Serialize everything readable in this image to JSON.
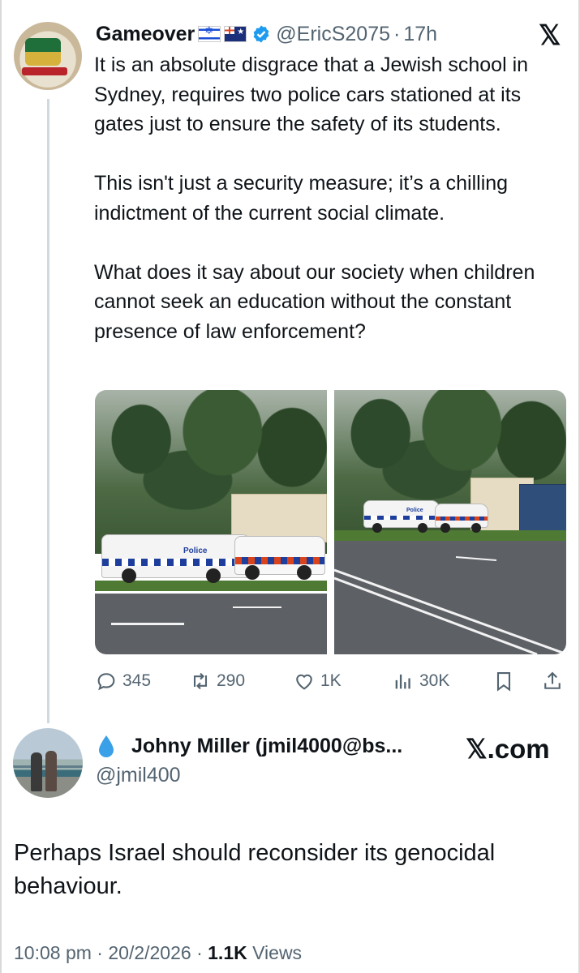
{
  "tweet": {
    "author_name": "Gameover",
    "handle": "@EricS2075",
    "separator": "·",
    "age": "17h",
    "flags": [
      "israel-flag",
      "australia-flag"
    ],
    "platform_logo": "𝕏",
    "paragraphs": [
      "It is an absolute disgrace that a Jewish school in Sydney, requires two police cars stationed at its gates just to ensure the safety of its students.",
      "This isn't just a security measure; it’s a chilling indictment of the current social climate.",
      "What does it say about our society when children cannot seek an education without the constant presence of law enforcement?"
    ],
    "photo_labels": [
      "Police",
      "Police"
    ],
    "actions": {
      "replies": "345",
      "retweets": "290",
      "likes": "1K",
      "views": "30K"
    }
  },
  "reply": {
    "author_name": "Johny Miller (jmil4000@bs...",
    "handle": "@jmil400",
    "source": "𝕏.com",
    "text": "Perhaps Israel should reconsider its genocidal behaviour.",
    "time": "10:08 pm",
    "dot": "·",
    "date": "20/2/2026",
    "views_count": "1.1K",
    "views_label": "Views"
  },
  "colors": {
    "text": "#0f1419",
    "secondary": "#536471",
    "verified": "#1d9bf0",
    "thread_line": "#cfd9de"
  }
}
